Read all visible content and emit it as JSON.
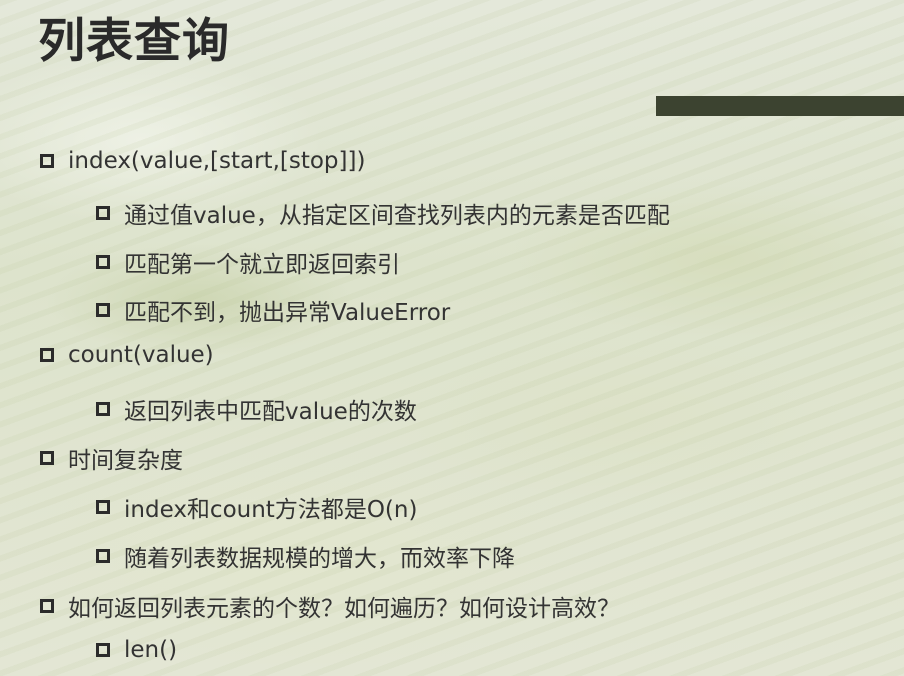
{
  "slide": {
    "title": "列表查询",
    "items": [
      {
        "text": "index(value,[start,[stop]])"
      },
      {
        "text": "通过值value，从指定区间查找列表内的元素是否匹配"
      },
      {
        "text": "匹配第一个就立即返回索引"
      },
      {
        "text": "匹配不到，抛出异常ValueError"
      },
      {
        "text": "count(value)"
      },
      {
        "text": "返回列表中匹配value的次数"
      },
      {
        "text": "时间复杂度"
      },
      {
        "text": "index和count方法都是O(n)"
      },
      {
        "text": "随着列表数据规模的增大，而效率下降"
      },
      {
        "text": "如何返回列表元素的个数？如何遍历？如何设计高效？"
      },
      {
        "text": "len()"
      }
    ]
  },
  "colors": {
    "title": "#2a2a2a",
    "text": "#333333",
    "accent_bar": "#3c4330"
  }
}
